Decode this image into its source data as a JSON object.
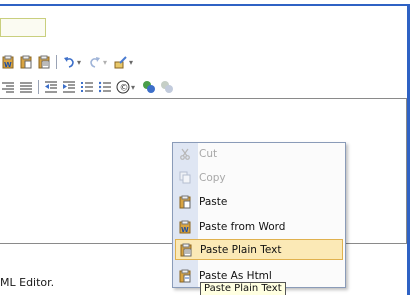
{
  "toolbar_row1": {
    "items": [
      {
        "icon": "paste-from-word-icon"
      },
      {
        "icon": "paste-icon"
      },
      {
        "icon": "paste-plain-text-icon"
      },
      {
        "icon": "undo-icon"
      },
      {
        "icon": "redo-icon"
      },
      {
        "icon": "format-brush-icon"
      }
    ]
  },
  "toolbar_row2": {
    "items": [
      {
        "icon": "align-right-icon"
      },
      {
        "icon": "justify-icon"
      },
      {
        "icon": "outdent-icon"
      },
      {
        "icon": "indent-icon"
      },
      {
        "icon": "numbered-list-icon"
      },
      {
        "icon": "bulleted-list-icon"
      },
      {
        "icon": "insert-symbol-icon"
      },
      {
        "icon": "insert-link-icon"
      },
      {
        "icon": "remove-link-icon"
      }
    ]
  },
  "context_menu": {
    "items": [
      {
        "label": "Cut",
        "enabled": false,
        "icon": "cut-icon"
      },
      {
        "label": "Copy",
        "enabled": false,
        "icon": "copy-icon"
      },
      {
        "label": "Paste",
        "enabled": true,
        "icon": "paste-icon"
      },
      {
        "label": "Paste from Word",
        "enabled": true,
        "icon": "paste-from-word-icon"
      },
      {
        "label": "Paste Plain Text",
        "enabled": true,
        "highlighted": true,
        "icon": "paste-plain-text-icon"
      },
      {
        "label": "Paste As Html",
        "enabled": true,
        "icon": "paste-as-html-icon"
      }
    ]
  },
  "tooltip": "Paste Plain Text",
  "status": {
    "text": "ML Editor."
  },
  "colors": {
    "frame": "#2f62c4",
    "highlight_bg": "#fbe9b6",
    "highlight_border": "#e0b14e",
    "menu_gutter": "#dfe6f3"
  }
}
